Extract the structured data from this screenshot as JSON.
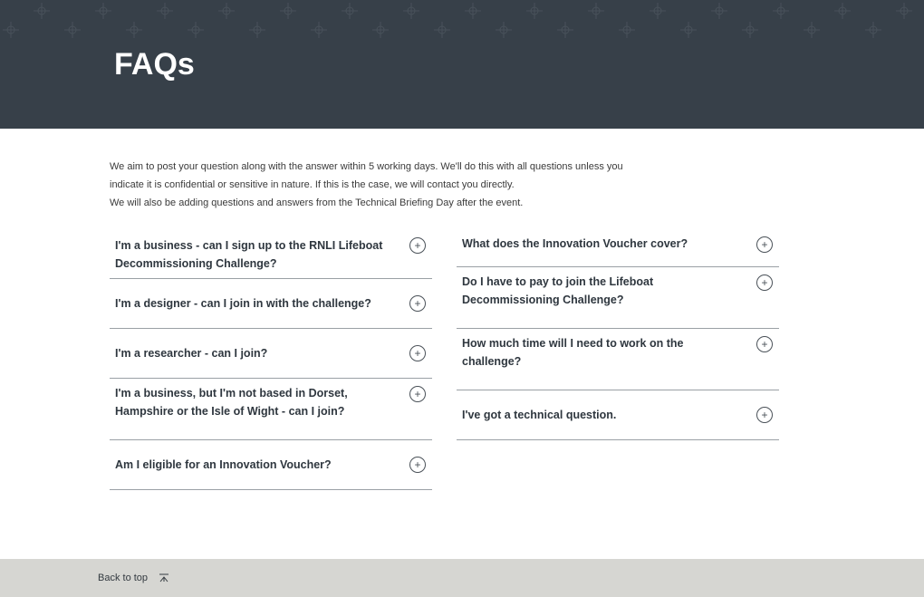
{
  "header": {
    "title": "FAQs",
    "background_color": "#374049"
  },
  "intro": {
    "line1": "We aim to post your question along with the answer within 5 working days. We'll do this with all questions unless you",
    "line2": "indicate it is confidential or sensitive in nature. If this is the case, we will contact you directly.",
    "line3": "We will also be adding questions and answers from the Technical Briefing Day after the event."
  },
  "faq": {
    "toggle_symbol": "+",
    "toggle_icon": "plus-circle-icon",
    "left": [
      {
        "question": "I'm a business - can I sign up to the RNLI Lifeboat Decommissioning Challenge?"
      },
      {
        "question": "I'm a designer - can I join in with the challenge?"
      },
      {
        "question": "I'm a researcher - can I join?"
      },
      {
        "question": "I'm a business, but I'm not based in Dorset, Hampshire or the Isle of Wight - can I join?"
      },
      {
        "question": "Am I eligible for an Innovation Voucher?"
      }
    ],
    "right": [
      {
        "question": "What does the Innovation Voucher cover?"
      },
      {
        "question": "Do I have to pay to join the Lifeboat Decommissioning Challenge?"
      },
      {
        "question": "How much time will I need to work on the challenge?"
      },
      {
        "question": "I've got a technical question."
      }
    ]
  },
  "footer": {
    "back_to_top": "Back to top",
    "icon": "up-arrow-icon",
    "background_color": "#d6d6d2"
  }
}
